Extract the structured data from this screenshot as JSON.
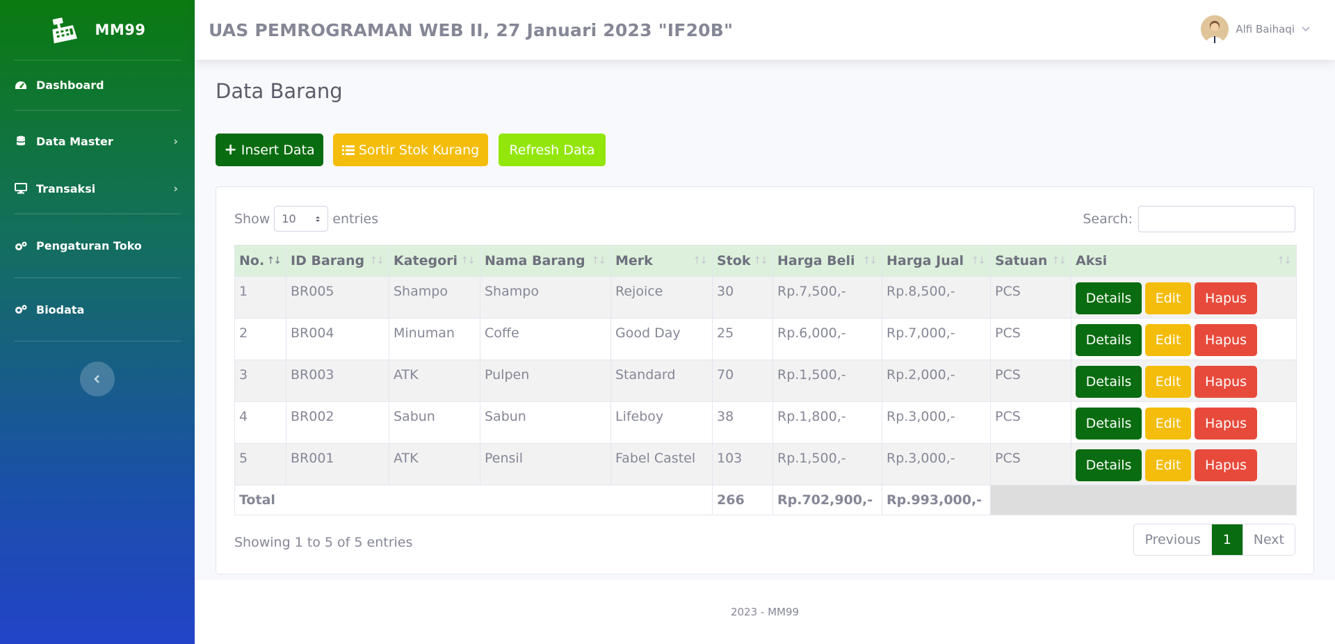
{
  "brand": {
    "name": "MM99"
  },
  "sidebar": {
    "items": [
      {
        "label": "Dashboard",
        "icon": "dashboard-icon"
      },
      {
        "label": "Data Master",
        "icon": "database-icon"
      },
      {
        "label": "Transaksi",
        "icon": "desktop-icon"
      },
      {
        "label": "Pengaturan Toko",
        "icon": "cogs-icon"
      },
      {
        "label": "Biodata",
        "icon": "cogs-icon"
      }
    ]
  },
  "topbar": {
    "title": "UAS PEMROGRAMAN WEB II, 27 Januari 2023 \"IF20B\"",
    "user_name": "Alfi Baihaqi"
  },
  "page": {
    "title": "Data Barang",
    "buttons": {
      "insert": "Insert Data",
      "sort": "Sortir Stok Kurang",
      "refresh": "Refresh Data"
    }
  },
  "table": {
    "show_label": "Show",
    "entries_value": "10",
    "entries_label": "entries",
    "search_label": "Search:",
    "columns": [
      "No.",
      "ID Barang",
      "Kategori",
      "Nama Barang",
      "Merk",
      "Stok",
      "Harga Beli",
      "Harga Jual",
      "Satuan",
      "Aksi"
    ],
    "rows": [
      [
        "1",
        "BR005",
        "Shampo",
        "Shampo",
        "Rejoice",
        "30",
        "Rp.7,500,-",
        "Rp.8,500,-",
        "PCS"
      ],
      [
        "2",
        "BR004",
        "Minuman",
        "Coffe",
        "Good Day",
        "25",
        "Rp.6,000,-",
        "Rp.7,000,-",
        "PCS"
      ],
      [
        "3",
        "BR003",
        "ATK",
        "Pulpen",
        "Standard",
        "70",
        "Rp.1,500,-",
        "Rp.2,000,-",
        "PCS"
      ],
      [
        "4",
        "BR002",
        "Sabun",
        "Sabun",
        "Lifeboy",
        "38",
        "Rp.1,800,-",
        "Rp.3,000,-",
        "PCS"
      ],
      [
        "5",
        "BR001",
        "ATK",
        "Pensil",
        "Fabel Castel",
        "103",
        "Rp.1,500,-",
        "Rp.3,000,-",
        "PCS"
      ]
    ],
    "actions": {
      "details": "Details",
      "edit": "Edit",
      "hapus": "Hapus"
    },
    "footer": {
      "label": "Total",
      "stok": "266",
      "harga_beli": "Rp.702,900,-",
      "harga_jual": "Rp.993,000,-"
    },
    "info": "Showing 1 to 5 of 5 entries",
    "pagination": {
      "previous": "Previous",
      "current": "1",
      "next": "Next"
    }
  },
  "footer": {
    "text": "2023 - MM99"
  },
  "colors": {
    "primary_green": "#0a6c10",
    "warning_yellow": "#f4bd0b",
    "lime": "#93e60b",
    "danger_red": "#e74a3b",
    "header_green": "#ddf0dc"
  }
}
